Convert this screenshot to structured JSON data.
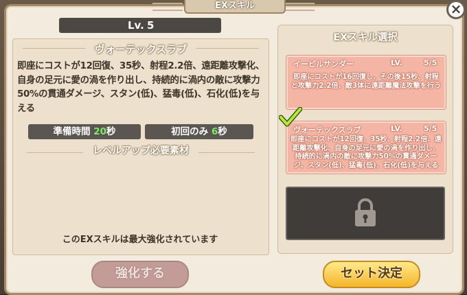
{
  "header": {
    "title": "EXスキル"
  },
  "close_label": "×",
  "level": {
    "label": "Lv.",
    "value": "5"
  },
  "skill": {
    "name": "ヴォーテックスラブ",
    "description": "即座にコストが12回復、35秒、射程2.2倍、遠距離攻撃化、自身の足元に愛の渦を作り出し、持続的に渦内の敵に攻撃力50%の貫通ダメージ、スタン(低)、猛毒(低)、石化(低)を与える"
  },
  "stats": {
    "prep_label": "準備時間",
    "prep_value": "20",
    "prep_unit": "秒",
    "first_label": "初回のみ",
    "first_value": "6",
    "first_unit": "秒"
  },
  "materials_heading": "レベルアップ必要素材",
  "max_note": "このEXスキルは最大強化されています",
  "ex_select": {
    "title": "EXスキル選択",
    "cards": [
      {
        "name": "イービルサンダー",
        "lv_label": "LV.",
        "lv_value": "5/5",
        "description": "即座にコストが16回復し、その後15秒、射程と攻撃力2.2倍、敵3体に遠距離魔法攻撃を行う"
      },
      {
        "name": "ヴォーテックスラブ",
        "lv_label": "LV.",
        "lv_value": "5/5",
        "description": "即座にコストが12回復、35秒、射程2.2倍、遠距離攻撃化、自身の足元に愛の渦を作り出し、持続的に渦内の敵に攻撃力50%の貫通ダメージ、スタン(低)、猛毒(低)、石化(低)を与える",
        "selected": true
      }
    ],
    "locked_slot": "lock-icon"
  },
  "buttons": {
    "enhance": "強化する",
    "confirm": "セット決定"
  },
  "colors": {
    "accent_green": "#7ee86a",
    "card_pink": "#f4b5a5",
    "gold": "#f5b52b"
  }
}
